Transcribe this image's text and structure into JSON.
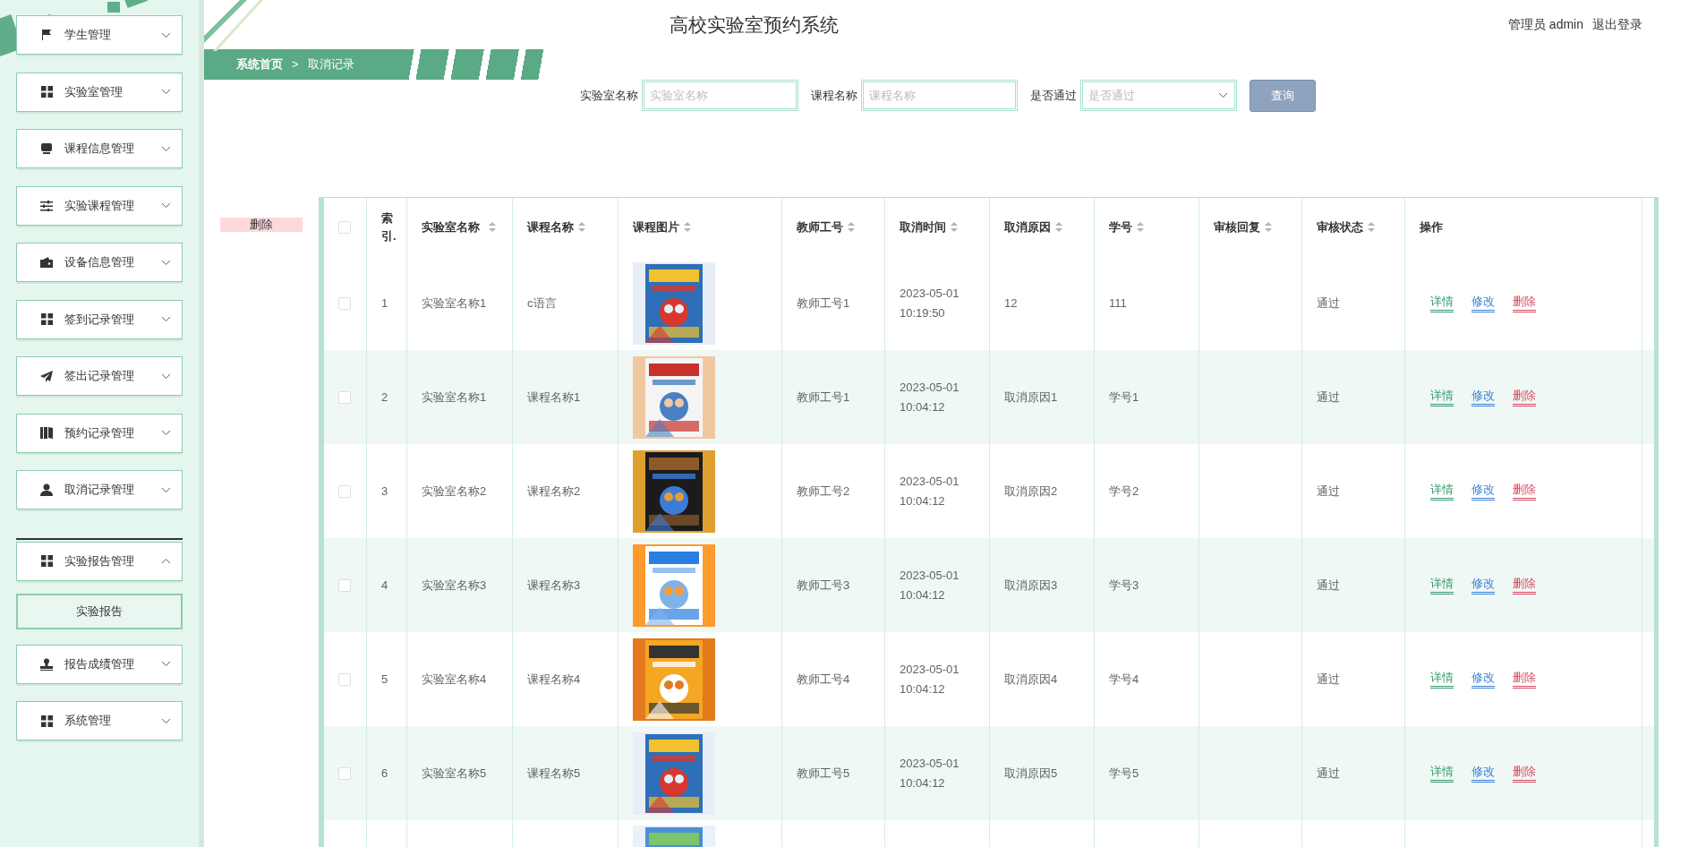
{
  "header": {
    "title": "高校实验室预约系统",
    "user": "管理员 admin",
    "logout": "退出登录"
  },
  "breadcrumb": [
    {
      "label": "系统首页",
      "selected": false
    },
    {
      "label": ">",
      "kind": "separator"
    },
    {
      "label": "取消记录",
      "selected": true
    }
  ],
  "sidebar": {
    "items": [
      {
        "label": "学生管理",
        "kind": "flag",
        "expanded": false
      },
      {
        "label": "实验室管理",
        "kind": "grid",
        "expanded": false
      },
      {
        "label": "课程信息管理",
        "kind": "box",
        "expanded": false
      },
      {
        "label": "实验课程管理",
        "kind": "sliders",
        "expanded": false
      },
      {
        "label": "设备信息管理",
        "kind": "wallet",
        "expanded": false
      },
      {
        "label": "签到记录管理",
        "kind": "grid",
        "expanded": false
      },
      {
        "label": "签出记录管理",
        "kind": "send",
        "expanded": false
      },
      {
        "label": "预约记录管理",
        "kind": "book",
        "expanded": false
      },
      {
        "label": "取消记录管理",
        "kind": "user",
        "expanded": false
      },
      {
        "label": "实验报告管理",
        "kind": "grid",
        "expanded": true,
        "children": [
          {
            "label": "实验报告",
            "selected": true
          }
        ]
      },
      {
        "label": "报告成绩管理",
        "kind": "stamp",
        "expanded": false
      },
      {
        "label": "系统管理",
        "kind": "grid",
        "expanded": false
      }
    ]
  },
  "search": {
    "fields": [
      {
        "label": "实验室名称",
        "placeholder": "实验室名称",
        "kind": "text"
      },
      {
        "label": "课程名称",
        "placeholder": "课程名称",
        "kind": "text"
      },
      {
        "label": "是否通过",
        "placeholder": "是否通过",
        "kind": "select"
      }
    ],
    "button": "查询"
  },
  "delete_button": "删除",
  "table": {
    "select_all": {
      "checked": false
    },
    "columns": [
      {
        "label": "索引.",
        "sortable": false
      },
      {
        "label": "实验室名称",
        "sortable": true
      },
      {
        "label": "课程名称",
        "sortable": true
      },
      {
        "label": "课程图片",
        "sortable": true
      },
      {
        "label": "教师工号",
        "sortable": true
      },
      {
        "label": "取消时间",
        "sortable": true
      },
      {
        "label": "取消原因",
        "sortable": true
      },
      {
        "label": "学号",
        "sortable": true
      },
      {
        "label": "审核回复",
        "sortable": true
      },
      {
        "label": "审核状态",
        "sortable": true
      },
      {
        "label": "操作",
        "sortable": false
      }
    ],
    "rows": [
      {
        "checked": false,
        "index": "1",
        "lab": "实验室名称1",
        "course": "c语言",
        "teacher": "教师工号1",
        "time": "2023-05-01 10:19:50",
        "reason": "12",
        "student": "111",
        "status": "通过",
        "actions": [
          {
            "label": "详情",
            "color": "#3a9a6e"
          },
          {
            "label": "修改",
            "color": "#3b82d6"
          },
          {
            "label": "删除",
            "color": "#d9485f"
          }
        ]
      },
      {
        "checked": false,
        "index": "2",
        "lab": "实验室名称1",
        "course": "课程名称1",
        "teacher": "教师工号1",
        "time": "2023-05-01 10:04:12",
        "reason": "取消原因1",
        "student": "学号1",
        "status": "通过",
        "actions": [
          {
            "label": "详情",
            "color": "#3a9a6e"
          },
          {
            "label": "修改",
            "color": "#3b82d6"
          },
          {
            "label": "删除",
            "color": "#d9485f"
          }
        ]
      },
      {
        "checked": false,
        "index": "3",
        "lab": "实验室名称2",
        "course": "课程名称2",
        "teacher": "教师工号2",
        "time": "2023-05-01 10:04:12",
        "reason": "取消原因2",
        "student": "学号2",
        "status": "通过",
        "actions": [
          {
            "label": "详情",
            "color": "#3a9a6e"
          },
          {
            "label": "修改",
            "color": "#3b82d6"
          },
          {
            "label": "删除",
            "color": "#d9485f"
          }
        ]
      },
      {
        "checked": false,
        "index": "4",
        "lab": "实验室名称3",
        "course": "课程名称3",
        "teacher": "教师工号3",
        "time": "2023-05-01 10:04:12",
        "reason": "取消原因3",
        "student": "学号3",
        "status": "通过",
        "actions": [
          {
            "label": "详情",
            "color": "#3a9a6e"
          },
          {
            "label": "修改",
            "color": "#3b82d6"
          },
          {
            "label": "删除",
            "color": "#d9485f"
          }
        ]
      },
      {
        "checked": false,
        "index": "5",
        "lab": "实验室名称4",
        "course": "课程名称4",
        "teacher": "教师工号4",
        "time": "2023-05-01 10:04:12",
        "reason": "取消原因4",
        "student": "学号4",
        "status": "通过",
        "actions": [
          {
            "label": "详情",
            "color": "#3a9a6e"
          },
          {
            "label": "修改",
            "color": "#3b82d6"
          },
          {
            "label": "删除",
            "color": "#d9485f"
          }
        ]
      },
      {
        "checked": false,
        "index": "6",
        "lab": "实验室名称5",
        "course": "课程名称5",
        "teacher": "教师工号5",
        "time": "2023-05-01 10:04:12",
        "reason": "取消原因5",
        "student": "学号5",
        "status": "通过",
        "actions": [
          {
            "label": "详情",
            "color": "#3a9a6e"
          },
          {
            "label": "修改",
            "color": "#3b82d6"
          },
          {
            "label": "删除",
            "color": "#d9485f"
          }
        ]
      }
    ]
  }
}
